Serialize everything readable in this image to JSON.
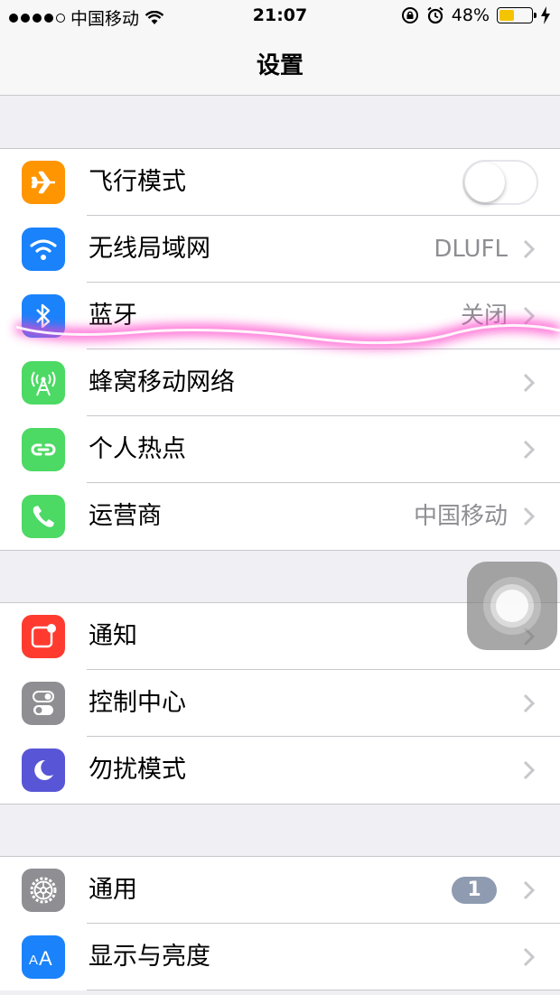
{
  "status_bar": {
    "carrier": "中国移动",
    "time": "21:07",
    "battery_percent": "48%",
    "battery_level": 0.48
  },
  "nav": {
    "title": "设置"
  },
  "groups": [
    {
      "rows": [
        {
          "label": "飞行模式",
          "icon": "airplane-icon",
          "icon_color": "#ff9500",
          "toggle_on": false
        },
        {
          "label": "无线局域网",
          "icon": "wifi-icon",
          "icon_color": "#1a82fb",
          "value": "DLUFL"
        },
        {
          "label": "蓝牙",
          "icon": "bluetooth-icon",
          "icon_color": "#1a82fb",
          "value": "关闭"
        },
        {
          "label": "蜂窝移动网络",
          "icon": "cellular-icon",
          "icon_color": "#4cd964"
        },
        {
          "label": "个人热点",
          "icon": "hotspot-icon",
          "icon_color": "#4cd964"
        },
        {
          "label": "运营商",
          "icon": "phone-icon",
          "icon_color": "#4cd964",
          "value": "中国移动"
        }
      ]
    },
    {
      "rows": [
        {
          "label": "通知",
          "icon": "notifications-icon",
          "icon_color": "#ff3b30"
        },
        {
          "label": "控制中心",
          "icon": "control-center-icon",
          "icon_color": "#8e8e93"
        },
        {
          "label": "勿扰模式",
          "icon": "moon-icon",
          "icon_color": "#5856d6"
        }
      ]
    },
    {
      "rows": [
        {
          "label": "通用",
          "icon": "gear-icon",
          "icon_color": "#8e8e93",
          "badge": "1"
        },
        {
          "label": "显示与亮度",
          "icon": "text-size-icon",
          "icon_color": "#1a82fb"
        }
      ]
    }
  ]
}
